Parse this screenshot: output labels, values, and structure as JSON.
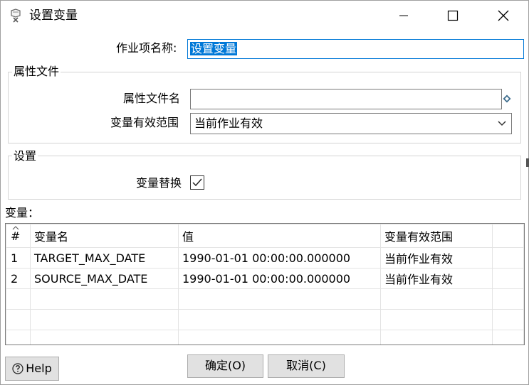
{
  "window": {
    "title": "设置变量",
    "minimize_icon": "minimize-icon",
    "maximize_icon": "maximize-icon",
    "close_icon": "close-icon"
  },
  "job_name": {
    "label": "作业项名称:",
    "value": "设置变量"
  },
  "properties_group": {
    "title": "属性文件",
    "file_label": "属性文件名",
    "file_value": "",
    "scope_label": "变量有效范围",
    "scope_value": "当前作业有效"
  },
  "settings_group": {
    "title": "设置",
    "replace_label": "变量替换",
    "replace_checked": true
  },
  "variables": {
    "label": "变量：",
    "columns": [
      "#",
      "变量名",
      "值",
      "变量有效范围",
      ""
    ],
    "rows": [
      {
        "num": "1",
        "name": "TARGET_MAX_DATE",
        "value": "1990-01-01 00:00:00.000000",
        "scope": "当前作业有效"
      },
      {
        "num": "2",
        "name": "SOURCE_MAX_DATE",
        "value": "1990-01-01 00:00:00.000000",
        "scope": "当前作业有效"
      }
    ]
  },
  "buttons": {
    "help": "Help",
    "ok": "确定(O)",
    "cancel": "取消(C)"
  },
  "colors": {
    "accent": "#0078d7",
    "button_bg": "#e1e1e1",
    "border": "#7a7a7a"
  }
}
